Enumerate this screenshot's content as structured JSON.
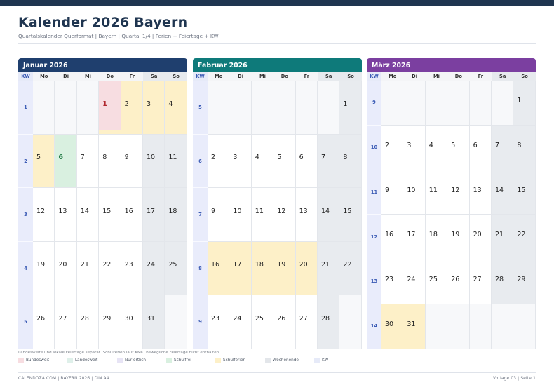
{
  "title": "Kalender 2026 Bayern",
  "subtitle": "Quartalskalender Querformat  |  Bayern | Quartal 1/4 | Ferien + Feiertage + KW",
  "weekday_header": {
    "kw": "KW",
    "days": [
      "Mo",
      "Di",
      "Mi",
      "Do",
      "Fr",
      "Sa",
      "So"
    ]
  },
  "months": [
    {
      "name": "Januar 2026",
      "color": "#1f3f6e",
      "weeks": [
        {
          "kw": "1",
          "days": [
            null,
            null,
            null,
            "1",
            "2",
            "3",
            "4"
          ],
          "types": [
            "empty",
            "empty",
            "empty",
            "bw",
            "sf",
            "sf",
            "sf"
          ]
        },
        {
          "kw": "2",
          "days": [
            "5",
            "6",
            "7",
            "8",
            "9",
            "10",
            "11"
          ],
          "types": [
            "sf",
            "sfrei",
            "",
            "",
            "",
            "we",
            "we"
          ]
        },
        {
          "kw": "3",
          "days": [
            "12",
            "13",
            "14",
            "15",
            "16",
            "17",
            "18"
          ],
          "types": [
            "",
            "",
            "",
            "",
            "",
            "we",
            "we"
          ]
        },
        {
          "kw": "4",
          "days": [
            "19",
            "20",
            "21",
            "22",
            "23",
            "24",
            "25"
          ],
          "types": [
            "",
            "",
            "",
            "",
            "",
            "we",
            "we"
          ]
        },
        {
          "kw": "5",
          "days": [
            "26",
            "27",
            "28",
            "29",
            "30",
            "31",
            null
          ],
          "types": [
            "",
            "",
            "",
            "",
            "",
            "we",
            "empty"
          ]
        }
      ]
    },
    {
      "name": "Februar 2026",
      "color": "#0e7a7a",
      "weeks": [
        {
          "kw": "5",
          "days": [
            null,
            null,
            null,
            null,
            null,
            null,
            "1"
          ],
          "types": [
            "empty",
            "empty",
            "empty",
            "empty",
            "empty",
            "empty",
            "we"
          ]
        },
        {
          "kw": "6",
          "days": [
            "2",
            "3",
            "4",
            "5",
            "6",
            "7",
            "8"
          ],
          "types": [
            "",
            "",
            "",
            "",
            "",
            "we",
            "we"
          ]
        },
        {
          "kw": "7",
          "days": [
            "9",
            "10",
            "11",
            "12",
            "13",
            "14",
            "15"
          ],
          "types": [
            "",
            "",
            "",
            "",
            "",
            "we",
            "we"
          ]
        },
        {
          "kw": "8",
          "days": [
            "16",
            "17",
            "18",
            "19",
            "20",
            "21",
            "22"
          ],
          "types": [
            "sf",
            "sf",
            "sf",
            "sf",
            "sf",
            "we",
            "we"
          ]
        },
        {
          "kw": "9",
          "days": [
            "23",
            "24",
            "25",
            "26",
            "27",
            "28",
            null
          ],
          "types": [
            "",
            "",
            "",
            "",
            "",
            "we",
            "empty"
          ]
        }
      ]
    },
    {
      "name": "März 2026",
      "color": "#7b3fa0",
      "weeks": [
        {
          "kw": "9",
          "days": [
            null,
            null,
            null,
            null,
            null,
            null,
            "1"
          ],
          "types": [
            "empty",
            "empty",
            "empty",
            "empty",
            "empty",
            "empty",
            "we"
          ]
        },
        {
          "kw": "10",
          "days": [
            "2",
            "3",
            "4",
            "5",
            "6",
            "7",
            "8"
          ],
          "types": [
            "",
            "",
            "",
            "",
            "",
            "we",
            "we"
          ]
        },
        {
          "kw": "11",
          "days": [
            "9",
            "10",
            "11",
            "12",
            "13",
            "14",
            "15"
          ],
          "types": [
            "",
            "",
            "",
            "",
            "",
            "we",
            "we"
          ]
        },
        {
          "kw": "12",
          "days": [
            "16",
            "17",
            "18",
            "19",
            "20",
            "21",
            "22"
          ],
          "types": [
            "",
            "",
            "",
            "",
            "",
            "we",
            "we"
          ]
        },
        {
          "kw": "13",
          "days": [
            "23",
            "24",
            "25",
            "26",
            "27",
            "28",
            "29"
          ],
          "types": [
            "",
            "",
            "",
            "",
            "",
            "we",
            "we"
          ]
        },
        {
          "kw": "14",
          "days": [
            "30",
            "31",
            null,
            null,
            null,
            null,
            null
          ],
          "types": [
            "sf",
            "sf",
            "empty",
            "empty",
            "empty",
            "empty",
            "empty"
          ]
        }
      ]
    }
  ],
  "note": "Landesweite und lokale Feiertage separat. Schulferien laut KMK. bewegliche Feiertage nicht enthalten.",
  "legend": [
    {
      "label": "Bundesweit",
      "color": "#f7dde1"
    },
    {
      "label": "Landesweit",
      "color": "#dff0ea"
    },
    {
      "label": "Nur örtlich",
      "color": "#e7e4f5"
    },
    {
      "label": "Schulfrei",
      "color": "#d9f0e0"
    },
    {
      "label": "Schulferien",
      "color": "#fdf0c8"
    },
    {
      "label": "Wochenende",
      "color": "#e3e6ea"
    },
    {
      "label": "KW",
      "color": "#e6eaf8"
    }
  ],
  "footer_left": "CALENDOZA.COM  |  BAYERN 2026  |  DIN A4",
  "footer_right": "Vorlage 03  |  Seite 1"
}
